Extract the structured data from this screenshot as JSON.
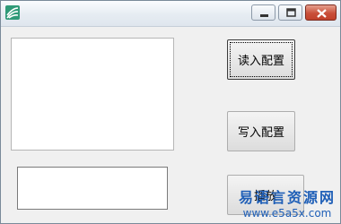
{
  "window": {
    "title": "",
    "accent_color": "#1f5fb7",
    "caption_buttons": [
      "minimize-icon",
      "maximize-icon",
      "close-icon"
    ]
  },
  "buttons": {
    "read_config": "读入配置",
    "write_config": "写入配置",
    "play": "播放"
  },
  "fields": {
    "text_box_value": ""
  },
  "watermark": {
    "site_name": "易语言资源网",
    "url": "www.e5a5x.com"
  }
}
